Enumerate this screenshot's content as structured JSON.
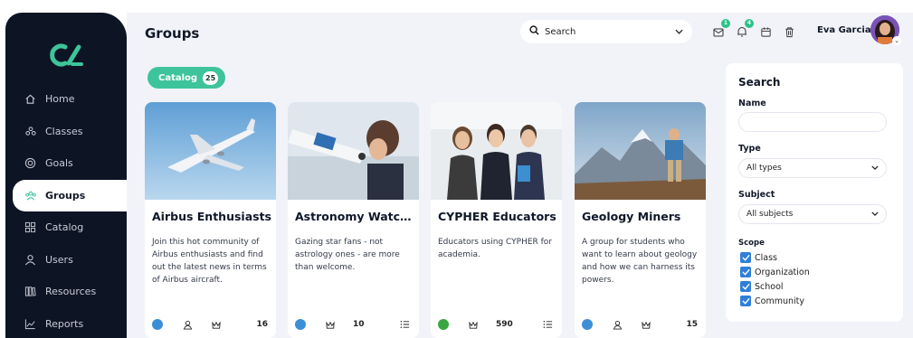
{
  "sidebar": {
    "items": [
      {
        "label": "Home",
        "icon": "home-icon"
      },
      {
        "label": "Classes",
        "icon": "classes-icon"
      },
      {
        "label": "Goals",
        "icon": "goals-icon"
      },
      {
        "label": "Groups",
        "icon": "groups-icon",
        "active": true
      },
      {
        "label": "Catalog",
        "icon": "catalog-icon"
      },
      {
        "label": "Users",
        "icon": "users-icon"
      },
      {
        "label": "Resources",
        "icon": "resources-icon"
      },
      {
        "label": "Reports",
        "icon": "reports-icon"
      }
    ]
  },
  "header": {
    "title": "Groups",
    "search_placeholder": "Search",
    "notif_badge_1": "1",
    "notif_badge_2": "4",
    "user_name": "Eva Garcia"
  },
  "catalog_tab": {
    "label": "Catalog",
    "count": "25"
  },
  "cards": [
    {
      "title": "Airbus Enthusiasts",
      "desc": "Join this hot community of Airbus enthusiasts and find out the latest news in terms of Airbus aircraft.",
      "count": "16"
    },
    {
      "title": "Astronomy Watch...",
      "desc": "Gazing star fans - not astrology ones - are more than welcome.",
      "count": "10"
    },
    {
      "title": "CYPHER Educators",
      "desc": "Educators using CYPHER for academia.",
      "count": "590"
    },
    {
      "title": "Geology Miners",
      "desc": "A group for students who want to learn about geology and how we can harness its powers.",
      "count": "15"
    }
  ],
  "panel": {
    "title": "Search",
    "name_label": "Name",
    "type_label": "Type",
    "type_value": "All types",
    "subject_label": "Subject",
    "subject_value": "All subjects",
    "scope_label": "Scope",
    "scope_options": [
      "Class",
      "Organization",
      "School",
      "Community"
    ]
  },
  "colors": {
    "sidebar_bg": "#0d1424",
    "accent": "#3ec49a",
    "check": "#2f7fd9",
    "main_bg": "#f1f3f8"
  }
}
